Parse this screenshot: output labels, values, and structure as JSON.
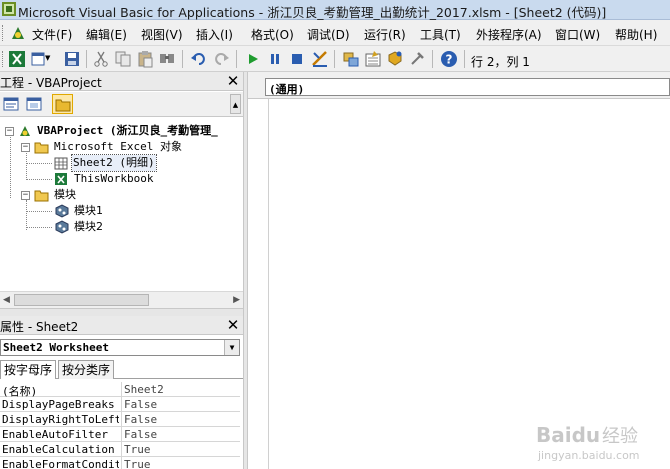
{
  "window": {
    "title": "Microsoft Visual Basic for Applications - 浙江贝良_考勤管理_出勤统计_2017.xlsm - [Sheet2 (代码)]"
  },
  "menu": [
    {
      "id": "file",
      "label": "文件(F)"
    },
    {
      "id": "edit",
      "label": "编辑(E)"
    },
    {
      "id": "view",
      "label": "视图(V)"
    },
    {
      "id": "insert",
      "label": "插入(I)"
    },
    {
      "id": "format",
      "label": "格式(O)"
    },
    {
      "id": "debug",
      "label": "调试(D)"
    },
    {
      "id": "run",
      "label": "运行(R)"
    },
    {
      "id": "tools",
      "label": "工具(T)"
    },
    {
      "id": "addins",
      "label": "外接程序(A)"
    },
    {
      "id": "window",
      "label": "窗口(W)"
    },
    {
      "id": "help",
      "label": "帮助(H)"
    }
  ],
  "toolbar": {
    "cursor_position": "行 2，列 1"
  },
  "project_panel": {
    "title": "工程 - VBAProject",
    "close": "✕",
    "tree": {
      "root": "VBAProject (浙江贝良_考勤管理_",
      "excel_objects": "Microsoft Excel 对象",
      "sheet2": "Sheet2 (明细)",
      "thisworkbook": "ThisWorkbook",
      "modules": "模块",
      "module1": "模块1",
      "module2": "模块2"
    }
  },
  "properties_panel": {
    "title": "属性 - Sheet2",
    "close": "✕",
    "object_select": "Sheet2 Worksheet",
    "tabs": [
      "按字母序",
      "按分类序"
    ],
    "rows": [
      {
        "name": "(名称)",
        "value": "Sheet2"
      },
      {
        "name": "DisplayPageBreaks",
        "value": "False"
      },
      {
        "name": "DisplayRightToLeft",
        "value": "False"
      },
      {
        "name": "EnableAutoFilter",
        "value": "False"
      },
      {
        "name": "EnableCalculation",
        "value": "True"
      },
      {
        "name": "EnableFormatConditio",
        "value": "True"
      }
    ]
  },
  "code_window": {
    "object_combo": "(通用)"
  },
  "watermark": {
    "text": "Baidu 经验",
    "url": "jingyan.baidu.com"
  },
  "colors": {
    "title_bar": "#c9daee",
    "chrome": "#f0f0f0",
    "accent_blue": "#1f5fb5",
    "run_green": "#1f9c2f"
  }
}
